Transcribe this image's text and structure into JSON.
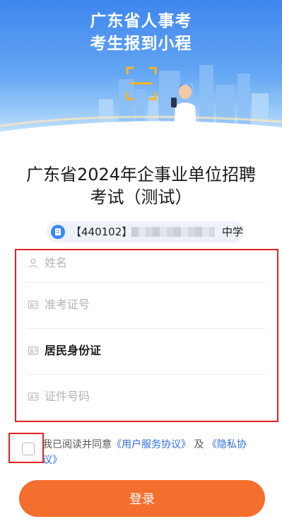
{
  "banner": {
    "title_line1": "广东省人事考",
    "title_line2": "考生报到小程",
    "colors": {
      "sky": "#4a8ff0",
      "frame": "#ffb21e"
    }
  },
  "exam": {
    "title_line1": "广东省2024年企事业单位招聘",
    "title_line2": "考试（测试）"
  },
  "unit": {
    "code": "【440102】",
    "suffix": "中学"
  },
  "form": {
    "name_placeholder": "姓名",
    "ticket_placeholder": "准考证号",
    "id_type_value": "居民身份证",
    "id_number_placeholder": "证件号码"
  },
  "agreement": {
    "prefix": "我已阅读并同意",
    "user_agreement": "《用户服务协议》",
    "conjunction": "及",
    "privacy_part1": "《隐私协",
    "privacy_part2": "议》"
  },
  "login": {
    "label": "登录",
    "color": "#f46e2e"
  }
}
